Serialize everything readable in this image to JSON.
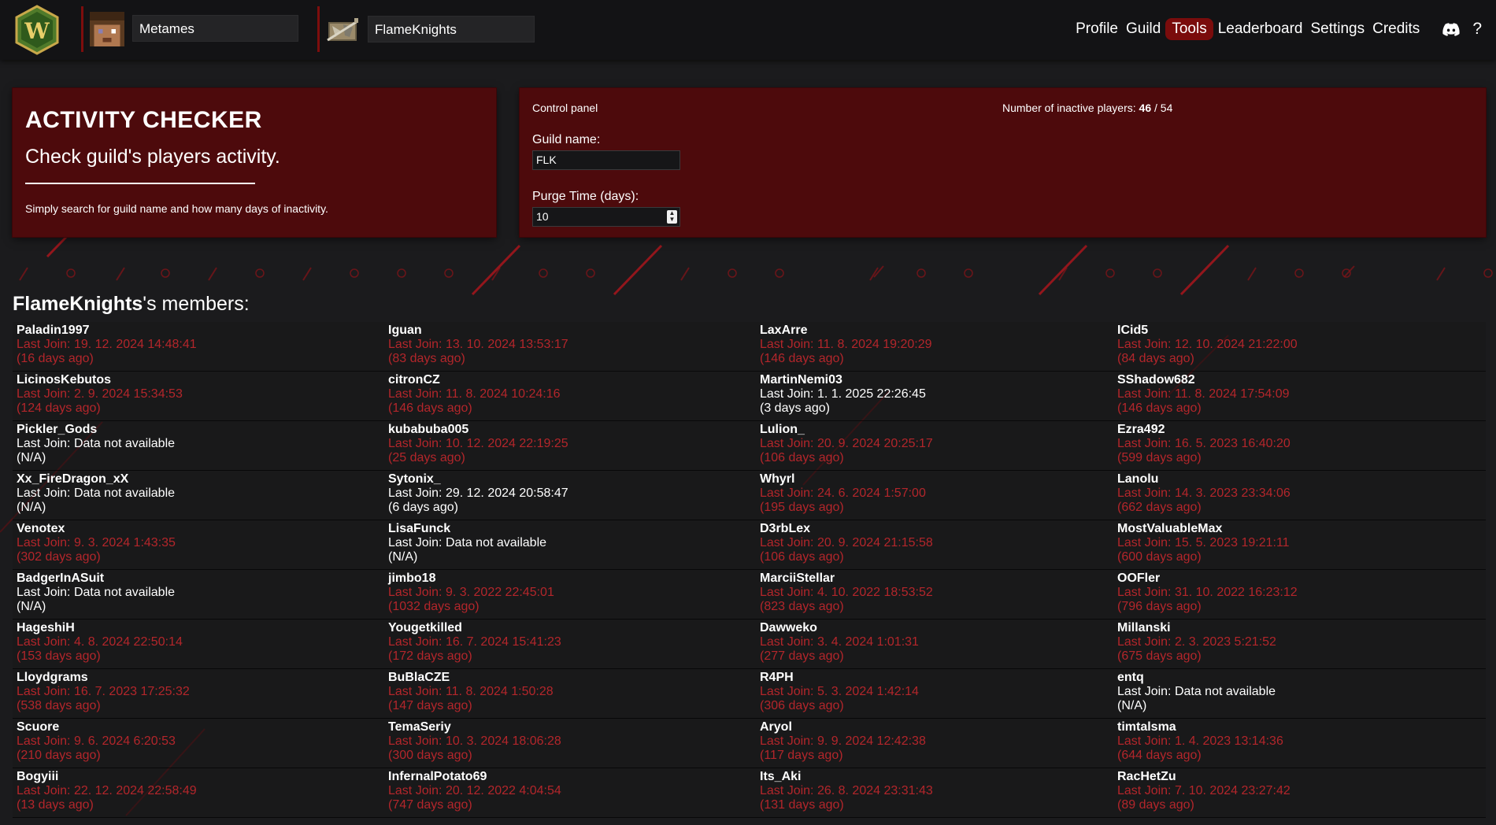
{
  "topbar": {
    "player_name": "Metames",
    "guild_name": "FlameKnights",
    "nav": [
      "Profile",
      "Guild",
      "Tools",
      "Leaderboard",
      "Settings",
      "Credits"
    ],
    "active_nav": "Tools",
    "help_label": "?"
  },
  "intro": {
    "title": "ACTIVITY CHECKER",
    "subtitle": "Check guild's players activity.",
    "description": "Simply search for guild name and how many days of inactivity."
  },
  "control_panel": {
    "title": "Control panel",
    "inactive_label": "Number of inactive players:",
    "inactive_count": "46",
    "total_count": "54",
    "guild_name_label": "Guild name:",
    "guild_name_value": "FLK",
    "purge_label": "Purge Time (days):",
    "purge_value": "10"
  },
  "members_section": {
    "guild": "FlameKnights",
    "suffix": "'s members:",
    "last_join_prefix": "Last Join: ",
    "columns": [
      [
        {
          "name": "Paladin1997",
          "last_join": "19. 12. 2024 14:48:41",
          "ago": "(16 days ago)",
          "inactive": true
        },
        {
          "name": "LicinosKebutos",
          "last_join": "2. 9. 2024 15:34:53",
          "ago": "(124 days ago)",
          "inactive": true
        },
        {
          "name": "Pickler_Gods",
          "last_join": "Data not available",
          "ago": "(N/A)",
          "inactive": false
        },
        {
          "name": "Xx_FireDragon_xX",
          "last_join": "Data not available",
          "ago": "(N/A)",
          "inactive": false
        },
        {
          "name": "Venotex",
          "last_join": "9. 3. 2024 1:43:35",
          "ago": "(302 days ago)",
          "inactive": true
        },
        {
          "name": "BadgerInASuit",
          "last_join": "Data not available",
          "ago": "(N/A)",
          "inactive": false
        },
        {
          "name": "HageshiH",
          "last_join": "4. 8. 2024 22:50:14",
          "ago": "(153 days ago)",
          "inactive": true
        },
        {
          "name": "Lloydgrams",
          "last_join": "16. 7. 2023 17:25:32",
          "ago": "(538 days ago)",
          "inactive": true
        },
        {
          "name": "Scuore",
          "last_join": "9. 6. 2024 6:20:53",
          "ago": "(210 days ago)",
          "inactive": true
        },
        {
          "name": "Bogyiii",
          "last_join": "22. 12. 2024 22:58:49",
          "ago": "(13 days ago)",
          "inactive": true
        }
      ],
      [
        {
          "name": "Iguan",
          "last_join": "13. 10. 2024 13:53:17",
          "ago": "(83 days ago)",
          "inactive": true
        },
        {
          "name": "citronCZ",
          "last_join": "11. 8. 2024 10:24:16",
          "ago": "(146 days ago)",
          "inactive": true
        },
        {
          "name": "kubabuba005",
          "last_join": "10. 12. 2024 22:19:25",
          "ago": "(25 days ago)",
          "inactive": true
        },
        {
          "name": "Sytonix_",
          "last_join": "29. 12. 2024 20:58:47",
          "ago": "(6 days ago)",
          "inactive": false
        },
        {
          "name": "LisaFunck",
          "last_join": "Data not available",
          "ago": "(N/A)",
          "inactive": false
        },
        {
          "name": "jimbo18",
          "last_join": "9. 3. 2022 22:45:01",
          "ago": "(1032 days ago)",
          "inactive": true
        },
        {
          "name": "Yougetkilled",
          "last_join": "16. 7. 2024 15:41:23",
          "ago": "(172 days ago)",
          "inactive": true
        },
        {
          "name": "BuBlaCZE",
          "last_join": "11. 8. 2024 1:50:28",
          "ago": "(147 days ago)",
          "inactive": true
        },
        {
          "name": "TemaSeriy",
          "last_join": "10. 3. 2024 18:06:28",
          "ago": "(300 days ago)",
          "inactive": true
        },
        {
          "name": "InfernalPotato69",
          "last_join": "20. 12. 2022 4:04:54",
          "ago": "(747 days ago)",
          "inactive": true
        }
      ],
      [
        {
          "name": "LaxArre",
          "last_join": "11. 8. 2024 19:20:29",
          "ago": "(146 days ago)",
          "inactive": true
        },
        {
          "name": "MartinNemi03",
          "last_join": "1. 1. 2025 22:26:45",
          "ago": "(3 days ago)",
          "inactive": false
        },
        {
          "name": "Lulion_",
          "last_join": "20. 9. 2024 20:25:17",
          "ago": "(106 days ago)",
          "inactive": true
        },
        {
          "name": "Whyrl",
          "last_join": "24. 6. 2024 1:57:00",
          "ago": "(195 days ago)",
          "inactive": true
        },
        {
          "name": "D3rbLex",
          "last_join": "20. 9. 2024 21:15:58",
          "ago": "(106 days ago)",
          "inactive": true
        },
        {
          "name": "MarciiStellar",
          "last_join": "4. 10. 2022 18:53:52",
          "ago": "(823 days ago)",
          "inactive": true
        },
        {
          "name": "Dawweko",
          "last_join": "3. 4. 2024 1:01:31",
          "ago": "(277 days ago)",
          "inactive": true
        },
        {
          "name": "R4PH",
          "last_join": "5. 3. 2024 1:42:14",
          "ago": "(306 days ago)",
          "inactive": true
        },
        {
          "name": "Aryol",
          "last_join": "9. 9. 2024 12:42:38",
          "ago": "(117 days ago)",
          "inactive": true
        },
        {
          "name": "Its_Aki",
          "last_join": "26. 8. 2024 23:31:43",
          "ago": "(131 days ago)",
          "inactive": true
        }
      ],
      [
        {
          "name": "ICid5",
          "last_join": "12. 10. 2024 21:22:00",
          "ago": "(84 days ago)",
          "inactive": true
        },
        {
          "name": "SShadow682",
          "last_join": "11. 8. 2024 17:54:09",
          "ago": "(146 days ago)",
          "inactive": true
        },
        {
          "name": "Ezra492",
          "last_join": "16. 5. 2023 16:40:20",
          "ago": "(599 days ago)",
          "inactive": true
        },
        {
          "name": "Lanolu",
          "last_join": "14. 3. 2023 23:34:06",
          "ago": "(662 days ago)",
          "inactive": true
        },
        {
          "name": "MostValuableMax",
          "last_join": "15. 5. 2023 19:21:11",
          "ago": "(600 days ago)",
          "inactive": true
        },
        {
          "name": "OOFler",
          "last_join": "31. 10. 2022 16:23:12",
          "ago": "(796 days ago)",
          "inactive": true
        },
        {
          "name": "Millanski",
          "last_join": "2. 3. 2023 5:21:52",
          "ago": "(675 days ago)",
          "inactive": true
        },
        {
          "name": "entq",
          "last_join": "Data not available",
          "ago": "(N/A)",
          "inactive": false
        },
        {
          "name": "timtalsma",
          "last_join": "1. 4. 2023 13:14:36",
          "ago": "(644 days ago)",
          "inactive": true
        },
        {
          "name": "RacHetZu",
          "last_join": "7. 10. 2024 23:27:42",
          "ago": "(89 days ago)",
          "inactive": true
        }
      ]
    ]
  }
}
